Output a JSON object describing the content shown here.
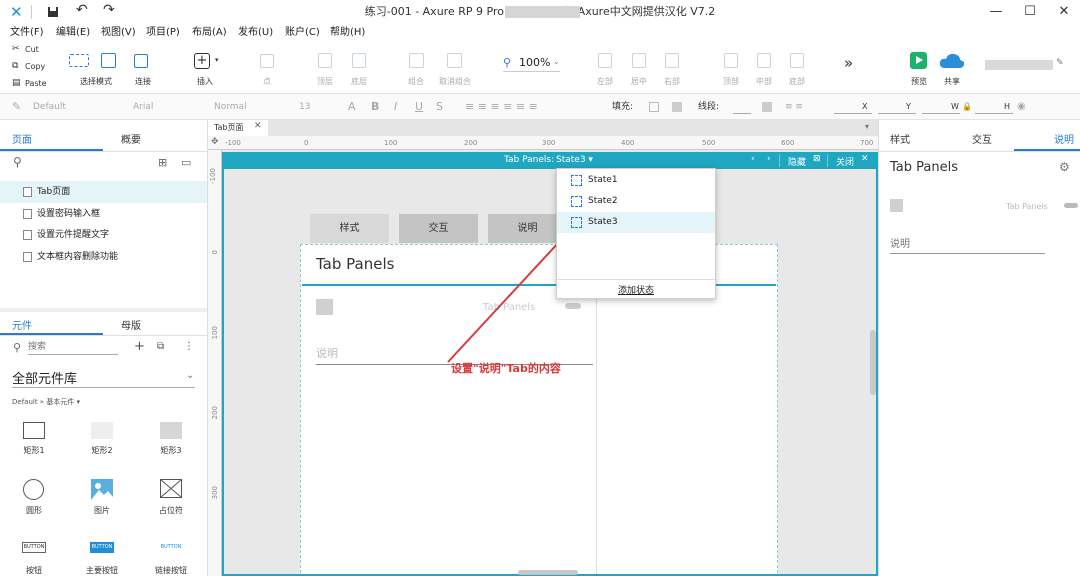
{
  "window": {
    "title": "练习-001 - Axure RP 9 Pro Edition : .         权    Axure中文网提供汉化 V7.2",
    "minimize": "—",
    "maximize": "☐",
    "close": "✕"
  },
  "menu": [
    "文件(F)",
    "编辑(E)",
    "视图(V)",
    "项目(P)",
    "布局(A)",
    "发布(U)",
    "账户(C)",
    "帮助(H)"
  ],
  "clipboard": {
    "cut": "Cut",
    "copy": "Copy",
    "paste": "Paste"
  },
  "toolbar": {
    "select_mode": "选择模式",
    "connect": "连接",
    "insert": "插入",
    "point": "点",
    "top_layer": "顶层",
    "bottom_layer": "底层",
    "group": "组合",
    "ungroup": "取消组合",
    "zoom": "100%",
    "left": "左部",
    "center": "居中",
    "right": "右部",
    "top": "顶部",
    "middle": "中部",
    "bottom": "底部",
    "more": "»",
    "preview": "预览",
    "share": "共享",
    "colors": {
      "preview": "#1bb36b",
      "share": "#2a8fd8"
    }
  },
  "formatbar": {
    "style": "Default",
    "font": "Arial",
    "weight": "Normal",
    "size": "13",
    "bold": "B",
    "italic": "I",
    "underline": "U",
    "strike": "S",
    "letter_a": "A",
    "fill": "填充:",
    "line": "线段:",
    "x": "X",
    "y": "Y",
    "w": "W",
    "h": "H"
  },
  "leftpanel": {
    "tabs": [
      "页面",
      "概要"
    ],
    "pages": [
      "Tab页面",
      "设置密码输入框",
      "设置元件提醒文字",
      "文本框内容删除功能"
    ],
    "lib_tabs": [
      "元件",
      "母版"
    ],
    "search_placeholder": "搜索",
    "library_name": "全部元件库",
    "breadcrumb": "Default » 基本元件 ▾",
    "widgets": [
      "矩形1",
      "矩形2",
      "矩形3",
      "圆形",
      "图片",
      "占位符",
      "按钮",
      "主要按钮",
      "链接按钮"
    ],
    "button_text": "BUTTON"
  },
  "canvas": {
    "doc_tab": "Tab页面",
    "ruler_top": [
      "-100",
      "0",
      "100",
      "200",
      "300",
      "400",
      "500",
      "600",
      "700"
    ],
    "ruler_left": [
      "-100",
      "0",
      "100",
      "200",
      "300"
    ],
    "panel_label": "Tab Panels:",
    "panel_state": "State3 ▾",
    "hide": "隐藏",
    "close": "关闭",
    "tabs": [
      "样式",
      "交互",
      "说明"
    ],
    "widget_title": "Tab Panels",
    "inner_label": "Tab Panels",
    "desc_placeholder": "说明",
    "annotation": "设置\"说明\"Tab的内容",
    "accent": "#1fa7c2"
  },
  "dropdown": {
    "states": [
      "State1",
      "State2",
      "State3"
    ],
    "add_state": "添加状态",
    "selected": 2
  },
  "rightpanel": {
    "tabs": [
      "样式",
      "交互",
      "说明"
    ],
    "title": "Tab Panels",
    "label": "Tab Panels",
    "desc_placeholder": "说明"
  }
}
